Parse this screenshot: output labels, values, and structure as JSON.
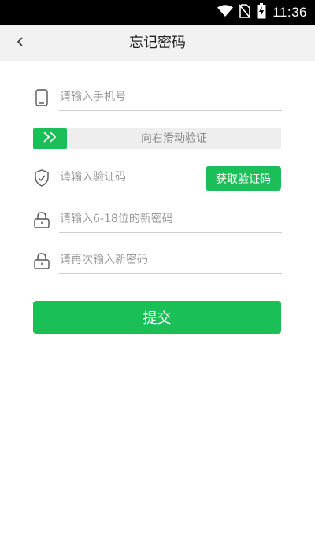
{
  "status_bar": {
    "time": "11:36",
    "icons": [
      "wifi-icon",
      "no-sim-icon",
      "battery-charging-icon"
    ]
  },
  "nav": {
    "title": "忘记密码",
    "back_icon": "chevron-left-icon"
  },
  "form": {
    "phone": {
      "placeholder": "请输入手机号",
      "value": "",
      "icon": "phone-icon"
    },
    "slider": {
      "label": "向右滑动验证",
      "icon": "double-chevron-right-icon"
    },
    "code": {
      "placeholder": "请输入验证码",
      "value": "",
      "icon": "shield-check-icon"
    },
    "get_code_label": "获取验证码",
    "new_password": {
      "placeholder": "请输入6-18位的新密码",
      "value": "",
      "icon": "lock-icon"
    },
    "confirm_password": {
      "placeholder": "请再次输入新密码",
      "value": "",
      "icon": "lock-icon"
    },
    "submit_label": "提交"
  },
  "colors": {
    "accent": "#1bbf58",
    "nav_background": "#f2f2f2",
    "slider_track": "#eeeeee"
  }
}
